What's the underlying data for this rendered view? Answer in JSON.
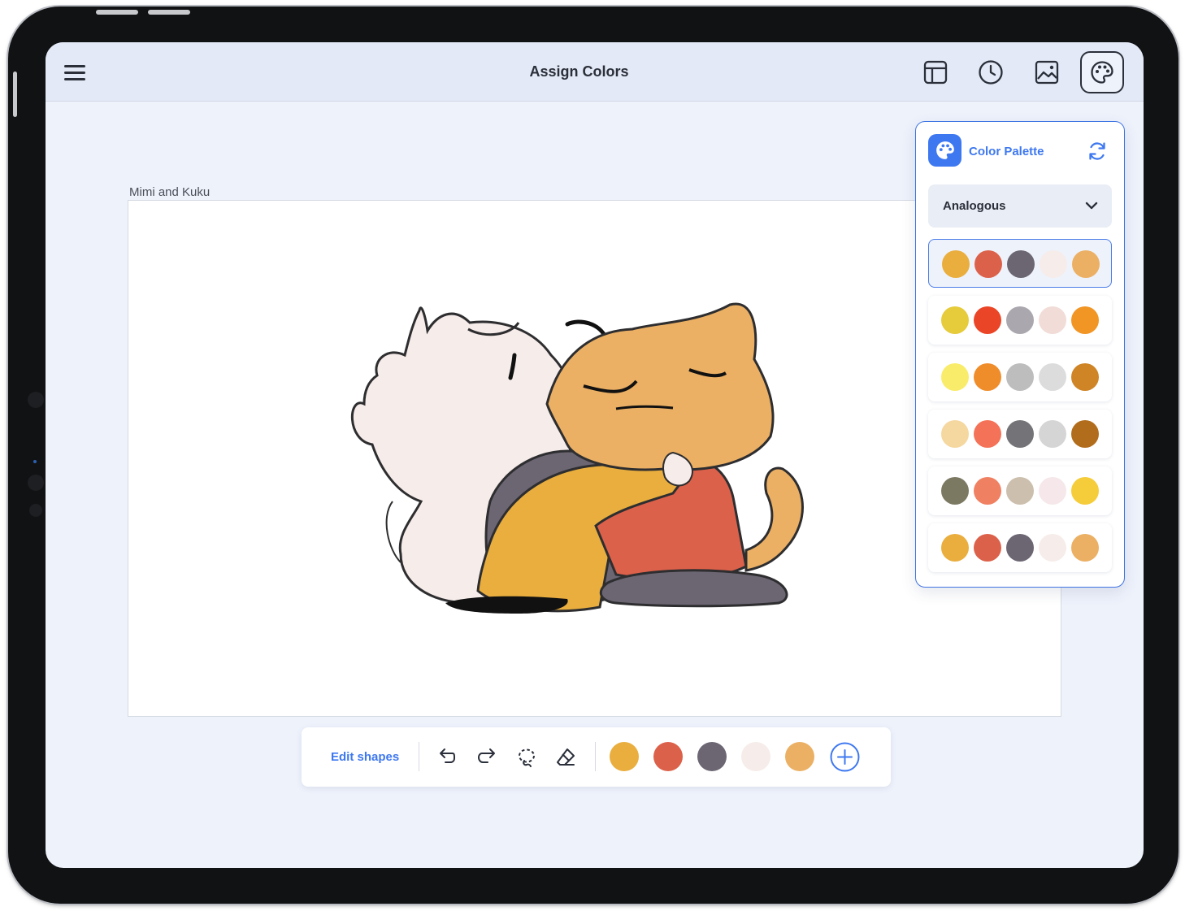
{
  "header": {
    "title": "Assign Colors"
  },
  "document": {
    "name": "Mimi and Kuku"
  },
  "palette_panel": {
    "title": "Color Palette",
    "scheme": "Analogous",
    "selected_index": 0,
    "palettes": [
      [
        "#E9AE3E",
        "#DC614A",
        "#6C6673",
        "#F6ECEA",
        "#EBB064"
      ],
      [
        "#E6CB3B",
        "#EB4527",
        "#ABA7AE",
        "#F1DCD7",
        "#F19525"
      ],
      [
        "#F9EC6A",
        "#F08D2B",
        "#BDBDBD",
        "#DCDCDC",
        "#CF8426"
      ],
      [
        "#F5D7A0",
        "#F47257",
        "#747478",
        "#D5D5D5",
        "#B16D1C"
      ],
      [
        "#7C7963",
        "#F08062",
        "#CCBFAD",
        "#F6E7EA",
        "#F5CC3A"
      ],
      [
        "#E9AE3E",
        "#DC614A",
        "#6C6673",
        "#F6ECEA",
        "#EBB064"
      ]
    ]
  },
  "toolbar": {
    "edit_shapes_label": "Edit shapes",
    "tools": [
      "undo-icon",
      "redo-icon",
      "lasso-icon",
      "eraser-icon"
    ],
    "swatches": [
      "#E9AE3E",
      "#DC614A",
      "#6C6673",
      "#F6ECEA",
      "#EBB064"
    ]
  },
  "colors": {
    "accent": "#3E78F0",
    "topbar_bg": "#E3E9F6",
    "screen_bg": "#EEF2FB"
  }
}
